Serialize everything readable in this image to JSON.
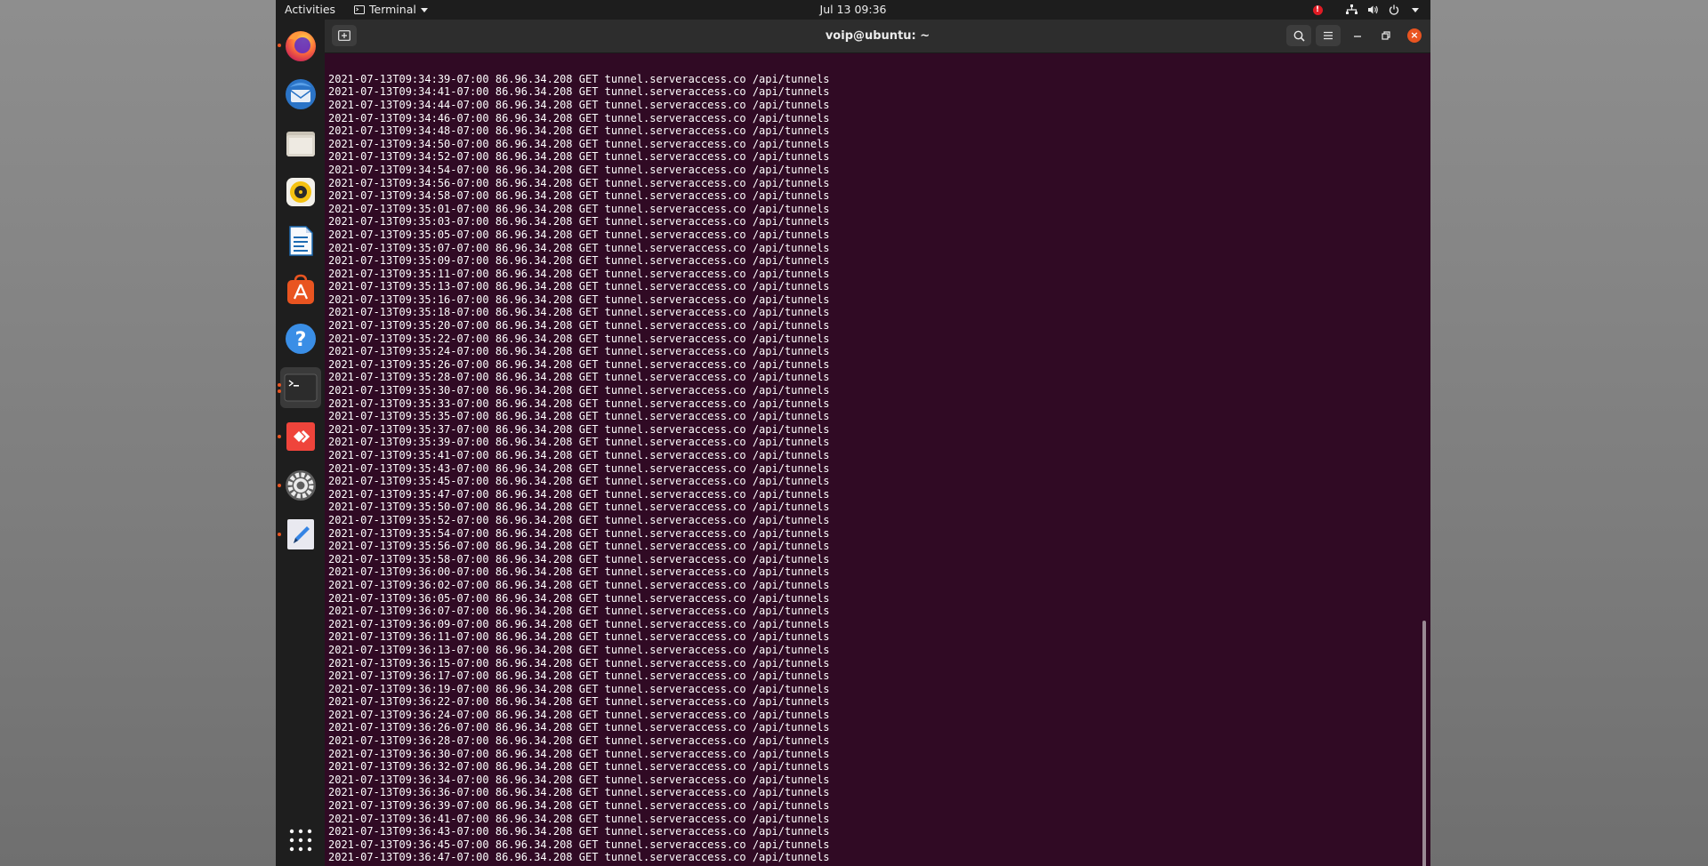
{
  "topbar": {
    "activities": "Activities",
    "app_name": "Terminal",
    "clock": "Jul 13  09:36",
    "alert": "!"
  },
  "window": {
    "title": "voip@ubuntu: ~"
  },
  "dock": {
    "items": [
      {
        "name": "firefox",
        "running": true,
        "color": "#ff7139"
      },
      {
        "name": "thunderbird",
        "running": false,
        "color": "#2b74c7"
      },
      {
        "name": "files",
        "running": false,
        "color": "#c9c3b6"
      },
      {
        "name": "rhythmbox",
        "running": false,
        "color": "#f5c211"
      },
      {
        "name": "libreoffice-writer",
        "running": false,
        "color": "#1e6cb3"
      },
      {
        "name": "ubuntu-software",
        "running": false,
        "color": "#e95420"
      },
      {
        "name": "help",
        "running": false,
        "color": "#3a8ee6"
      },
      {
        "name": "terminal",
        "running": true,
        "color": "#2c2c2c"
      },
      {
        "name": "anydesk",
        "running": true,
        "color": "#ef443b"
      },
      {
        "name": "settings",
        "running": true,
        "color": "#9a9a9a"
      },
      {
        "name": "text-editor",
        "running": true,
        "color": "#e9e9f0"
      }
    ]
  },
  "terminal": {
    "lines": [
      "2021-07-13T09:34:39-07:00 86.96.34.208 GET tunnel.serveraccess.co /api/tunnels",
      "2021-07-13T09:34:41-07:00 86.96.34.208 GET tunnel.serveraccess.co /api/tunnels",
      "2021-07-13T09:34:44-07:00 86.96.34.208 GET tunnel.serveraccess.co /api/tunnels",
      "2021-07-13T09:34:46-07:00 86.96.34.208 GET tunnel.serveraccess.co /api/tunnels",
      "2021-07-13T09:34:48-07:00 86.96.34.208 GET tunnel.serveraccess.co /api/tunnels",
      "2021-07-13T09:34:50-07:00 86.96.34.208 GET tunnel.serveraccess.co /api/tunnels",
      "2021-07-13T09:34:52-07:00 86.96.34.208 GET tunnel.serveraccess.co /api/tunnels",
      "2021-07-13T09:34:54-07:00 86.96.34.208 GET tunnel.serveraccess.co /api/tunnels",
      "2021-07-13T09:34:56-07:00 86.96.34.208 GET tunnel.serveraccess.co /api/tunnels",
      "2021-07-13T09:34:58-07:00 86.96.34.208 GET tunnel.serveraccess.co /api/tunnels",
      "2021-07-13T09:35:01-07:00 86.96.34.208 GET tunnel.serveraccess.co /api/tunnels",
      "2021-07-13T09:35:03-07:00 86.96.34.208 GET tunnel.serveraccess.co /api/tunnels",
      "2021-07-13T09:35:05-07:00 86.96.34.208 GET tunnel.serveraccess.co /api/tunnels",
      "2021-07-13T09:35:07-07:00 86.96.34.208 GET tunnel.serveraccess.co /api/tunnels",
      "2021-07-13T09:35:09-07:00 86.96.34.208 GET tunnel.serveraccess.co /api/tunnels",
      "2021-07-13T09:35:11-07:00 86.96.34.208 GET tunnel.serveraccess.co /api/tunnels",
      "2021-07-13T09:35:13-07:00 86.96.34.208 GET tunnel.serveraccess.co /api/tunnels",
      "2021-07-13T09:35:16-07:00 86.96.34.208 GET tunnel.serveraccess.co /api/tunnels",
      "2021-07-13T09:35:18-07:00 86.96.34.208 GET tunnel.serveraccess.co /api/tunnels",
      "2021-07-13T09:35:20-07:00 86.96.34.208 GET tunnel.serveraccess.co /api/tunnels",
      "2021-07-13T09:35:22-07:00 86.96.34.208 GET tunnel.serveraccess.co /api/tunnels",
      "2021-07-13T09:35:24-07:00 86.96.34.208 GET tunnel.serveraccess.co /api/tunnels",
      "2021-07-13T09:35:26-07:00 86.96.34.208 GET tunnel.serveraccess.co /api/tunnels",
      "2021-07-13T09:35:28-07:00 86.96.34.208 GET tunnel.serveraccess.co /api/tunnels",
      "2021-07-13T09:35:30-07:00 86.96.34.208 GET tunnel.serveraccess.co /api/tunnels",
      "2021-07-13T09:35:33-07:00 86.96.34.208 GET tunnel.serveraccess.co /api/tunnels",
      "2021-07-13T09:35:35-07:00 86.96.34.208 GET tunnel.serveraccess.co /api/tunnels",
      "2021-07-13T09:35:37-07:00 86.96.34.208 GET tunnel.serveraccess.co /api/tunnels",
      "2021-07-13T09:35:39-07:00 86.96.34.208 GET tunnel.serveraccess.co /api/tunnels",
      "2021-07-13T09:35:41-07:00 86.96.34.208 GET tunnel.serveraccess.co /api/tunnels",
      "2021-07-13T09:35:43-07:00 86.96.34.208 GET tunnel.serveraccess.co /api/tunnels",
      "2021-07-13T09:35:45-07:00 86.96.34.208 GET tunnel.serveraccess.co /api/tunnels",
      "2021-07-13T09:35:47-07:00 86.96.34.208 GET tunnel.serveraccess.co /api/tunnels",
      "2021-07-13T09:35:50-07:00 86.96.34.208 GET tunnel.serveraccess.co /api/tunnels",
      "2021-07-13T09:35:52-07:00 86.96.34.208 GET tunnel.serveraccess.co /api/tunnels",
      "2021-07-13T09:35:54-07:00 86.96.34.208 GET tunnel.serveraccess.co /api/tunnels",
      "2021-07-13T09:35:56-07:00 86.96.34.208 GET tunnel.serveraccess.co /api/tunnels",
      "2021-07-13T09:35:58-07:00 86.96.34.208 GET tunnel.serveraccess.co /api/tunnels",
      "2021-07-13T09:36:00-07:00 86.96.34.208 GET tunnel.serveraccess.co /api/tunnels",
      "2021-07-13T09:36:02-07:00 86.96.34.208 GET tunnel.serveraccess.co /api/tunnels",
      "2021-07-13T09:36:05-07:00 86.96.34.208 GET tunnel.serveraccess.co /api/tunnels",
      "2021-07-13T09:36:07-07:00 86.96.34.208 GET tunnel.serveraccess.co /api/tunnels",
      "2021-07-13T09:36:09-07:00 86.96.34.208 GET tunnel.serveraccess.co /api/tunnels",
      "2021-07-13T09:36:11-07:00 86.96.34.208 GET tunnel.serveraccess.co /api/tunnels",
      "2021-07-13T09:36:13-07:00 86.96.34.208 GET tunnel.serveraccess.co /api/tunnels",
      "2021-07-13T09:36:15-07:00 86.96.34.208 GET tunnel.serveraccess.co /api/tunnels",
      "2021-07-13T09:36:17-07:00 86.96.34.208 GET tunnel.serveraccess.co /api/tunnels",
      "2021-07-13T09:36:19-07:00 86.96.34.208 GET tunnel.serveraccess.co /api/tunnels",
      "2021-07-13T09:36:22-07:00 86.96.34.208 GET tunnel.serveraccess.co /api/tunnels",
      "2021-07-13T09:36:24-07:00 86.96.34.208 GET tunnel.serveraccess.co /api/tunnels",
      "2021-07-13T09:36:26-07:00 86.96.34.208 GET tunnel.serveraccess.co /api/tunnels",
      "2021-07-13T09:36:28-07:00 86.96.34.208 GET tunnel.serveraccess.co /api/tunnels",
      "2021-07-13T09:36:30-07:00 86.96.34.208 GET tunnel.serveraccess.co /api/tunnels",
      "2021-07-13T09:36:32-07:00 86.96.34.208 GET tunnel.serveraccess.co /api/tunnels",
      "2021-07-13T09:36:34-07:00 86.96.34.208 GET tunnel.serveraccess.co /api/tunnels",
      "2021-07-13T09:36:36-07:00 86.96.34.208 GET tunnel.serveraccess.co /api/tunnels",
      "2021-07-13T09:36:39-07:00 86.96.34.208 GET tunnel.serveraccess.co /api/tunnels",
      "2021-07-13T09:36:41-07:00 86.96.34.208 GET tunnel.serveraccess.co /api/tunnels",
      "2021-07-13T09:36:43-07:00 86.96.34.208 GET tunnel.serveraccess.co /api/tunnels",
      "2021-07-13T09:36:45-07:00 86.96.34.208 GET tunnel.serveraccess.co /api/tunnels",
      "2021-07-13T09:36:47-07:00 86.96.34.208 GET tunnel.serveraccess.co /api/tunnels"
    ]
  }
}
